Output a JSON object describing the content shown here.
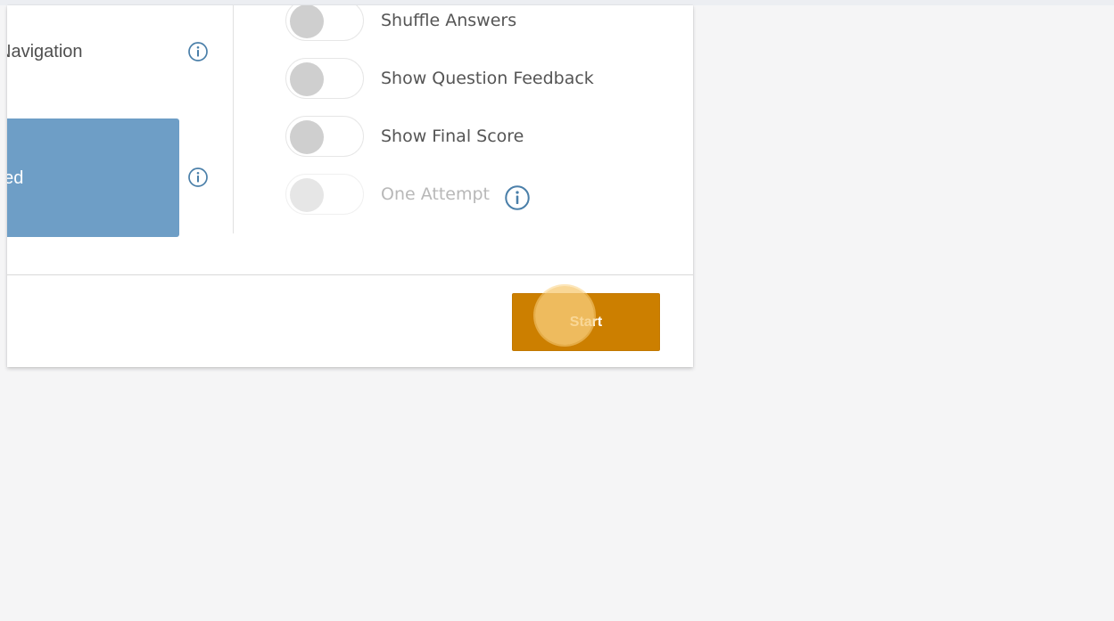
{
  "settings": {
    "navigation_label": "Navigation",
    "pace_option_label": "Teacher Paced",
    "toggles": [
      {
        "label": "Shuffle Answers",
        "on": false,
        "disabled": false
      },
      {
        "label": "Show Question Feedback",
        "on": false,
        "disabled": false
      },
      {
        "label": "Show Final Score",
        "on": false,
        "disabled": false
      },
      {
        "label": "One Attempt",
        "on": false,
        "disabled": true
      }
    ]
  },
  "footer": {
    "start_label": "Start"
  },
  "colors": {
    "pace_button": "#6e9ec6",
    "start_button": "#cc7f00",
    "info_icon": "#4a7fa9",
    "page_background": "#f5f5f6"
  },
  "icons": {
    "info": "info-circle-icon"
  }
}
